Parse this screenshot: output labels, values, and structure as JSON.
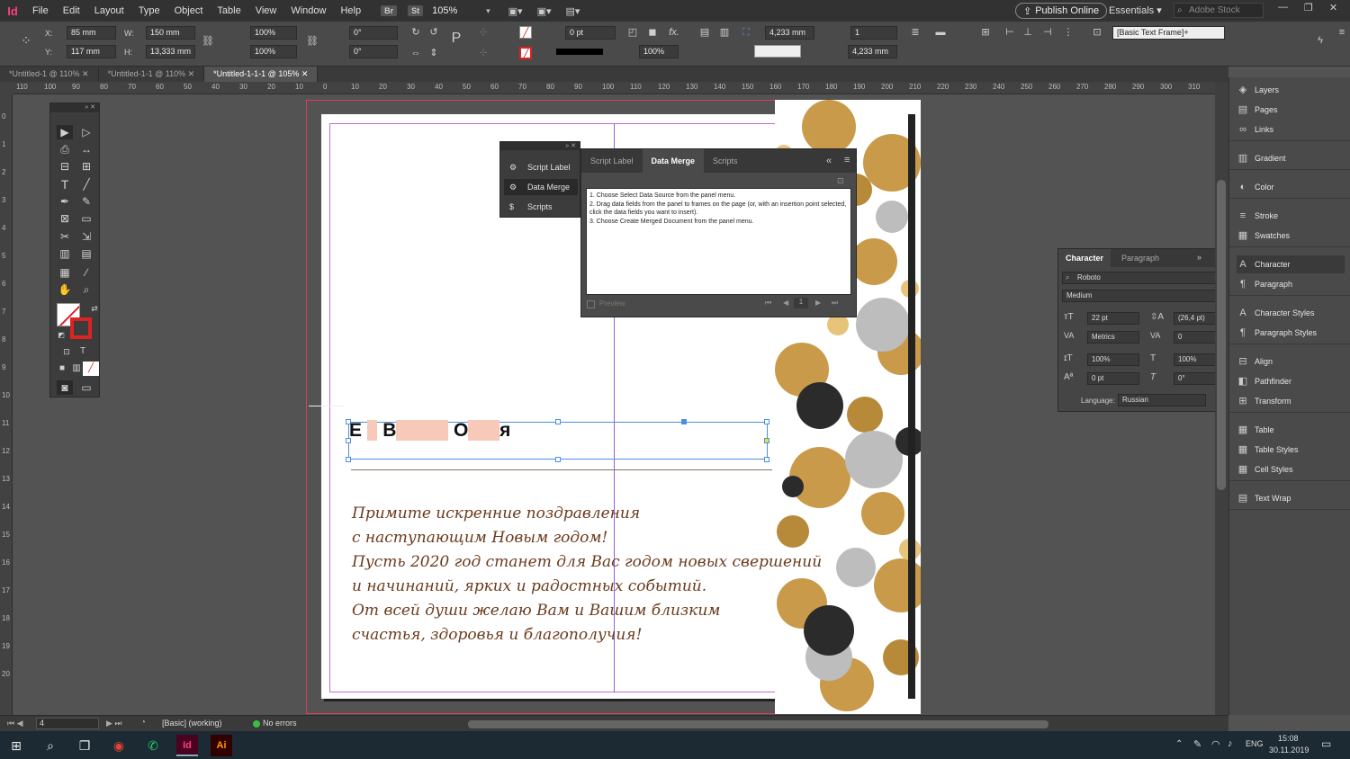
{
  "menubar": {
    "logo": "Id",
    "items": [
      "File",
      "Edit",
      "Layout",
      "Type",
      "Object",
      "Table",
      "View",
      "Window",
      "Help"
    ],
    "bridge_chip": "Br",
    "stock_chip": "St",
    "zoom": "105%",
    "publish_label": "Publish Online",
    "workspace": "Essentials",
    "stock_search_placeholder": "Adobe Stock"
  },
  "control": {
    "x": "85 mm",
    "y": "117 mm",
    "w": "150 mm",
    "h": "13,333 mm",
    "scale_x": "100%",
    "scale_y": "100%",
    "rotate": "0°",
    "shear": "0°",
    "stroke_weight": "0 pt",
    "opacity": "100%",
    "gutter_a": "4,233 mm",
    "gutter_b": "4,233 mm",
    "columns": "1",
    "frame_style": "[Basic Text Frame]+"
  },
  "tabs": [
    {
      "label": "*Untitled-1 @ 110%",
      "active": false
    },
    {
      "label": "*Untitled-1-1 @ 110%",
      "active": false
    },
    {
      "label": "*Untitled-1-1-1 @ 105%",
      "active": true
    }
  ],
  "ruler": {
    "h_ticks": [
      "110",
      "100",
      "90",
      "80",
      "70",
      "60",
      "50",
      "40",
      "30",
      "20",
      "10",
      "0",
      "10",
      "20",
      "30",
      "40",
      "50",
      "60",
      "70",
      "80",
      "90",
      "100",
      "110",
      "120",
      "130",
      "140",
      "150",
      "160",
      "170",
      "180",
      "190",
      "200",
      "210",
      "220",
      "230",
      "240",
      "250",
      "260",
      "270",
      "280",
      "290",
      "300",
      "310"
    ],
    "v_ticks": [
      "0",
      "1",
      "2",
      "3",
      "4",
      "5",
      "6",
      "7",
      "8",
      "9",
      "10",
      "11",
      "12",
      "13",
      "14",
      "15",
      "16",
      "17",
      "18",
      "19",
      "20"
    ]
  },
  "document": {
    "headline_parts": [
      "Е ",
      "▯",
      "В",
      "▯▯▯▯▯",
      "О",
      "▯▯▯",
      "я"
    ],
    "greeting_lines": [
      "Примите искренние поздравления",
      "с наступающим Новым годом!",
      "Пусть 2020 год станет для Вас годом новых свершений",
      "и начинаний, ярких и радостных событий.",
      "От всей души желаю Вам и Вашим близким",
      "счастья, здоровья и благополучия!"
    ]
  },
  "script_panel": {
    "items": [
      "Script Label",
      "Data Merge",
      "Scripts"
    ],
    "selected": "Data Merge"
  },
  "data_merge": {
    "tabs": [
      "Script Label",
      "Data Merge",
      "Scripts"
    ],
    "active_tab": "Data Merge",
    "instructions": [
      "1. Choose Select Data Source from the panel menu.",
      "2. Drag data fields from the panel to frames on the page (or, with an insertion point selected, click the data fields you want to insert).",
      "3. Choose Create Merged Document from the panel menu."
    ],
    "preview_label": "Preview",
    "record": "1"
  },
  "character_panel": {
    "tabs": [
      "Character",
      "Paragraph"
    ],
    "font": "Roboto",
    "style": "Medium",
    "size": "22 pt",
    "leading": "(26,4 pt)",
    "kerning": "Metrics",
    "tracking": "0",
    "vscale": "100%",
    "hscale": "100%",
    "baseline": "0 pt",
    "skew": "0°",
    "language_label": "Language:",
    "language": "Russian"
  },
  "dock": {
    "items": [
      {
        "label": "Layers",
        "icon": "layers-icon",
        "glyph": "◈"
      },
      {
        "label": "Pages",
        "icon": "pages-icon",
        "glyph": "▤"
      },
      {
        "label": "Links",
        "icon": "links-icon",
        "glyph": "∞"
      },
      {
        "label": "Gradient",
        "icon": "gradient-icon",
        "glyph": "▥"
      },
      {
        "label": "Color",
        "icon": "color-icon",
        "glyph": "◐"
      },
      {
        "label": "Stroke",
        "icon": "stroke-icon",
        "glyph": "≡"
      },
      {
        "label": "Swatches",
        "icon": "swatches-icon",
        "glyph": "▦"
      },
      {
        "label": "Character",
        "icon": "character-icon",
        "glyph": "A"
      },
      {
        "label": "Paragraph",
        "icon": "paragraph-icon",
        "glyph": "¶"
      },
      {
        "label": "Character Styles",
        "icon": "character-styles-icon",
        "glyph": "A"
      },
      {
        "label": "Paragraph Styles",
        "icon": "paragraph-styles-icon",
        "glyph": "¶"
      },
      {
        "label": "Align",
        "icon": "align-icon",
        "glyph": "⊟"
      },
      {
        "label": "Pathfinder",
        "icon": "pathfinder-icon",
        "glyph": "◧"
      },
      {
        "label": "Transform",
        "icon": "transform-icon",
        "glyph": "⊞"
      },
      {
        "label": "Table",
        "icon": "table-icon",
        "glyph": "▦"
      },
      {
        "label": "Table Styles",
        "icon": "table-styles-icon",
        "glyph": "▦"
      },
      {
        "label": "Cell Styles",
        "icon": "cell-styles-icon",
        "glyph": "▦"
      },
      {
        "label": "Text Wrap",
        "icon": "text-wrap-icon",
        "glyph": "▤"
      }
    ],
    "selected": "Character"
  },
  "status": {
    "page": "4",
    "style": "[Basic] (working)",
    "errors": "No errors"
  },
  "taskbar": {
    "lang": "ENG",
    "time": "15:08",
    "date": "30.11.2019"
  },
  "colors": {
    "indesign_pink": "#ff3e84",
    "illustrator_orange": "#ff9a00",
    "error_ok_green": "#3dbd45"
  }
}
